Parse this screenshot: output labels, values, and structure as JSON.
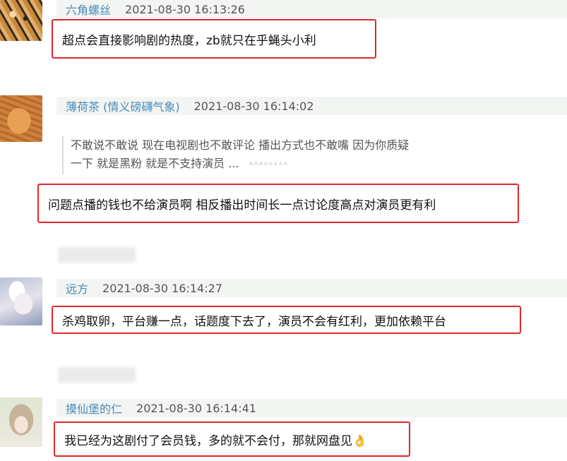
{
  "comments": [
    {
      "username": "六角螺丝",
      "time": "2021-08-30 16:13:26",
      "text": "超点会直接影响剧的热度，zb就只在乎蝇头小利"
    },
    {
      "username": "薄荷茶",
      "username_suffix": "(情义磅礴气象)",
      "time": "2021-08-30 16:14:02",
      "quote_line1": "不敢说不敢说 现在电视剧也不敢评论 播出方式也不敢嘴 因为你质疑",
      "quote_line2": "一下 就是黑粉 就是不支持演员 ...",
      "text": "问题点播的钱也不给演员啊 相反播出时间长一点讨论度高点对演员更有利"
    },
    {
      "username": "远方",
      "time": "2021-08-30 16:14:27",
      "text": "杀鸡取卵，平台赚一点，话题度下去了，演员不会有红利，更加依赖平台"
    },
    {
      "username": "摸仙堡的仁",
      "time": "2021-08-30 16:14:41",
      "text": "我已经为这剧付了会员钱，多的就不会付，那就网盘见👌"
    }
  ],
  "colors": {
    "highlight_border": "#e0282a",
    "username": "#4a8ab8",
    "header_bg": "#f2f5f2"
  }
}
